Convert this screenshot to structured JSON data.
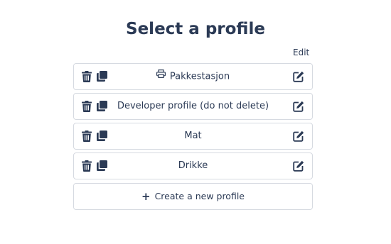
{
  "page": {
    "title": "Select a profile",
    "edit_label": "Edit"
  },
  "profiles": [
    {
      "name": "Pakkestasjon",
      "icon": "printer-icon"
    },
    {
      "name": "Developer profile (do not delete)"
    },
    {
      "name": "Mat"
    },
    {
      "name": "Drikke"
    }
  ],
  "create": {
    "label": "Create a new profile",
    "icon": "plus-icon"
  },
  "colors": {
    "text": "#2b3a55",
    "border": "#d6dae1",
    "background": "#ffffff"
  }
}
